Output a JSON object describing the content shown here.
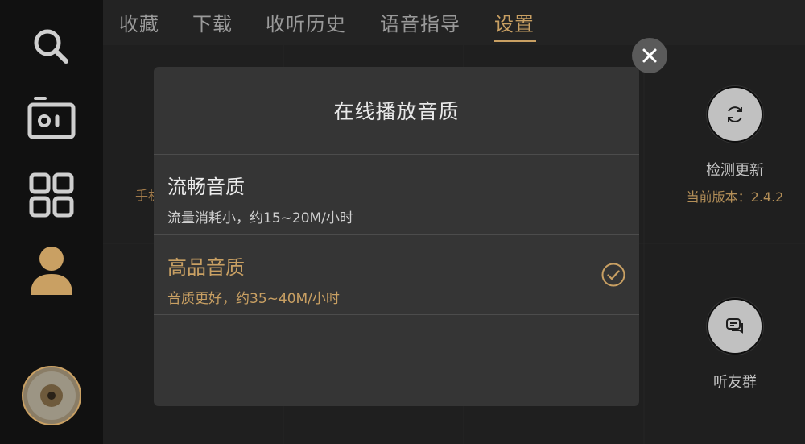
{
  "tabs": [
    {
      "label": "收藏"
    },
    {
      "label": "下载"
    },
    {
      "label": "收听历史"
    },
    {
      "label": "语音指导"
    },
    {
      "label": "设置"
    }
  ],
  "active_tab": "设置",
  "background": {
    "left_text": "手机",
    "update_card": {
      "title": "检测更新",
      "subtitle": "当前版本：2.4.2"
    },
    "group_card": {
      "title": "听友群"
    }
  },
  "modal": {
    "title": "在线播放音质",
    "options": [
      {
        "title": "流畅音质",
        "subtitle": "流量消耗小，约15~20M/小时",
        "selected": false
      },
      {
        "title": "高品音质",
        "subtitle": "音质更好，约35~40M/小时",
        "selected": true
      }
    ]
  },
  "sidebar": {
    "icons": [
      "search-icon",
      "radio-icon",
      "grid-icon",
      "user-icon",
      "album-disc-icon"
    ]
  },
  "colors": {
    "accent": "#c9a063",
    "background": "#232323",
    "sidebar": "#111111",
    "modal": "#353535"
  }
}
